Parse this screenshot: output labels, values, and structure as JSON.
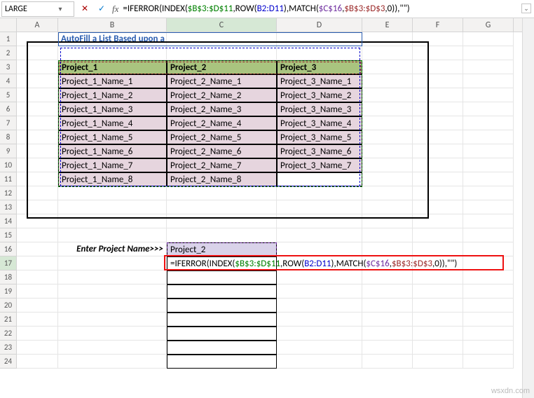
{
  "nameBox": {
    "value": "LARGE"
  },
  "formulaBar": {
    "plain": "=IFERROR(INDEX($B$3:$D$11,ROW(B2:D11),MATCH($C$16,$B$3:$D$3,0)),\"\")",
    "tokens": [
      {
        "t": "=IFERROR(INDEX(",
        "c": ""
      },
      {
        "t": "$B$3:$D$11",
        "c": "c-gr"
      },
      {
        "t": ",ROW(",
        "c": ""
      },
      {
        "t": "B2:D11",
        "c": "c-bl"
      },
      {
        "t": "),MATCH(",
        "c": ""
      },
      {
        "t": "$C$16",
        "c": "c-pu"
      },
      {
        "t": ",",
        "c": ""
      },
      {
        "t": "$B$3:$D$3",
        "c": "c-dr"
      },
      {
        "t": ",0)),\"\")",
        "c": ""
      }
    ]
  },
  "columns": [
    "A",
    "B",
    "C",
    "D",
    "E",
    "F",
    "G"
  ],
  "rowCount": 24,
  "title": "AutoFill a List Based upon a Cell Value",
  "headers": {
    "B": "Project_1",
    "C": "Project_2",
    "D": "Project_3"
  },
  "table": [
    {
      "B": "Project_1_Name_1",
      "C": "Project_2_Name_1",
      "D": "Project_3_Name_1"
    },
    {
      "B": "Project_1_Name_2",
      "C": "Project_2_Name_2",
      "D": "Project_3_Name_2"
    },
    {
      "B": "Project_1_Name_3",
      "C": "Project_2_Name_3",
      "D": "Project_3_Name_3"
    },
    {
      "B": "Project_1_Name_4",
      "C": "Project_2_Name_4",
      "D": "Project_3_Name_4"
    },
    {
      "B": "Project_1_Name_5",
      "C": "Project_2_Name_5",
      "D": "Project_3_Name_5"
    },
    {
      "B": "Project_1_Name_6",
      "C": "Project_2_Name_6",
      "D": "Project_3_Name_6"
    },
    {
      "B": "Project_1_Name_7",
      "C": "Project_2_Name_7",
      "D": "Project_3_Name_7"
    },
    {
      "B": "Project_1_Name_8",
      "C": "Project_2_Name_8",
      "D": ""
    }
  ],
  "enterLabel": "Enter Project Name>>>",
  "enterValue": "Project_2",
  "formulaCell": {
    "tokens": [
      {
        "t": "=IFERROR(INDEX(",
        "c": ""
      },
      {
        "t": "$B$3:$D$11",
        "c": "c-gr"
      },
      {
        "t": ",ROW(",
        "c": ""
      },
      {
        "t": "B2:D11",
        "c": "c-bl"
      },
      {
        "t": "),MATCH(",
        "c": ""
      },
      {
        "t": "$C$16",
        "c": "c-pu"
      },
      {
        "t": ",",
        "c": ""
      },
      {
        "t": "$B$3:$D$3",
        "c": "c-dr"
      },
      {
        "t": ",0)),\"\")",
        "c": ""
      }
    ]
  },
  "watermark": "wsxdn.com",
  "icons": {
    "cancel": "✕",
    "accept": "✓",
    "fx": "fx",
    "drop": "▾",
    "expand": "⌄"
  }
}
